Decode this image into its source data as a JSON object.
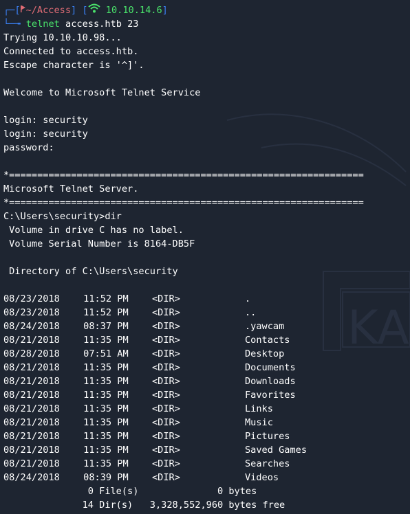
{
  "prompt": {
    "frame_top": "┌─[",
    "frame_mid": "] [",
    "frame_end": "]",
    "frame_bottom": "└─╼ ",
    "path": "~/Access",
    "ip": "10.10.14.6",
    "command": "telnet",
    "command_args": "access.htb 23"
  },
  "output": {
    "trying": "Trying 10.10.10.98...",
    "connected": "Connected to access.htb.",
    "escape": "Escape character is '^]'.",
    "welcome": "Welcome to Microsoft Telnet Service",
    "login1": "login: security",
    "login2": "login: security",
    "password": "password:",
    "sep1": "*===============================================================",
    "server": "Microsoft Telnet Server.",
    "sep2": "*===============================================================",
    "dir_cmd": "C:\\Users\\security>dir",
    "volume": " Volume in drive C has no label.",
    "serial": " Volume Serial Number is 8164-DB5F",
    "directory_of": " Directory of C:\\Users\\security"
  },
  "listing": [
    {
      "date": "08/23/2018",
      "time": " 11:52 PM",
      "type": "<DIR>",
      "name": "."
    },
    {
      "date": "08/23/2018",
      "time": " 11:52 PM",
      "type": "<DIR>",
      "name": ".."
    },
    {
      "date": "08/24/2018",
      "time": " 08:37 PM",
      "type": "<DIR>",
      "name": ".yawcam"
    },
    {
      "date": "08/21/2018",
      "time": " 11:35 PM",
      "type": "<DIR>",
      "name": "Contacts"
    },
    {
      "date": "08/28/2018",
      "time": " 07:51 AM",
      "type": "<DIR>",
      "name": "Desktop"
    },
    {
      "date": "08/21/2018",
      "time": " 11:35 PM",
      "type": "<DIR>",
      "name": "Documents"
    },
    {
      "date": "08/21/2018",
      "time": " 11:35 PM",
      "type": "<DIR>",
      "name": "Downloads"
    },
    {
      "date": "08/21/2018",
      "time": " 11:35 PM",
      "type": "<DIR>",
      "name": "Favorites"
    },
    {
      "date": "08/21/2018",
      "time": " 11:35 PM",
      "type": "<DIR>",
      "name": "Links"
    },
    {
      "date": "08/21/2018",
      "time": " 11:35 PM",
      "type": "<DIR>",
      "name": "Music"
    },
    {
      "date": "08/21/2018",
      "time": " 11:35 PM",
      "type": "<DIR>",
      "name": "Pictures"
    },
    {
      "date": "08/21/2018",
      "time": " 11:35 PM",
      "type": "<DIR>",
      "name": "Saved Games"
    },
    {
      "date": "08/21/2018",
      "time": " 11:35 PM",
      "type": "<DIR>",
      "name": "Searches"
    },
    {
      "date": "08/24/2018",
      "time": " 08:39 PM",
      "type": "<DIR>",
      "name": "Videos"
    }
  ],
  "summary": {
    "files_line": "               0 File(s)              0 bytes",
    "dirs_line": "              14 Dir(s)   3,328,552,960 bytes free"
  },
  "icons": {
    "flag": "flag-icon",
    "wifi": "wifi-icon"
  },
  "colors": {
    "background": "#1e2531",
    "text": "#ffffff",
    "prompt_frame": "#3b82f6",
    "path": "#e06c75",
    "ip": "#4ae36b",
    "command": "#4ae36b"
  }
}
